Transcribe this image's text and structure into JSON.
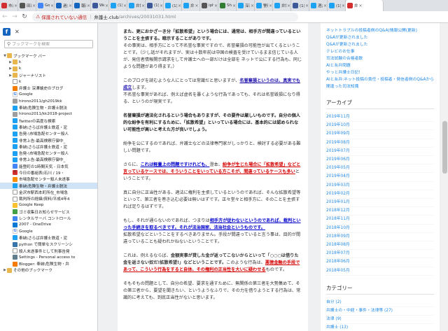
{
  "tabs": [
    {
      "title": "市長",
      "color": "#d32f2f"
    },
    {
      "title": "田口",
      "color": "#555555"
    },
    {
      "title": "Goog",
      "color": "#4285f4"
    },
    {
      "title": "過去",
      "color": "#1565c0"
    },
    {
      "title": "報道",
      "color": "#1565c0"
    },
    {
      "title": "Web",
      "color": "#3b5998"
    },
    {
      "title": "(1) ",
      "color": "#1da1f2"
    },
    {
      "title": "弁護",
      "color": "#1da1f2"
    },
    {
      "title": "(1)",
      "color": "#3b5998"
    },
    {
      "title": "(1) 弁",
      "color": "#1da1f2"
    },
    {
      "title": "弁",
      "color": "#1da1f2"
    },
    {
      "title": "iphor",
      "color": "#555555"
    },
    {
      "title": "Shok",
      "color": "#2e7d32"
    },
    {
      "title": "深澤",
      "color": "#1da1f2"
    },
    {
      "title": "警察",
      "color": "#1da1f2"
    },
    {
      "title": "弁護",
      "color": "#1da1f2"
    },
    {
      "title": "(1) 福",
      "color": "#3b5998"
    },
    {
      "title": "酒井",
      "color": "#1da1f2"
    },
    {
      "title": "(1) 弁",
      "color": "#1da1f2"
    },
    {
      "title": "弁",
      "color": "#d32f2f",
      "active": true
    }
  ],
  "address": {
    "warning": "保護されていない通信",
    "host": "弁護士.club",
    "path": "/archives/20031031.html"
  },
  "sidebar": {
    "search_placeholder": "ブックマークを検索",
    "items": [
      {
        "label": "ブックマーク バー",
        "icon": "folder-icon",
        "cls": "ico-folder",
        "indent": 0,
        "tw": "▼"
      },
      {
        "label": "k",
        "icon": "folder-icon",
        "cls": "ico-folder",
        "indent": 1,
        "tw": "▶"
      },
      {
        "label": "k",
        "icon": "folder-icon",
        "cls": "ico-folder",
        "indent": 1,
        "tw": "▶"
      },
      {
        "label": "ジャーナリスト",
        "icon": "folder-icon",
        "cls": "ico-folder",
        "indent": 1,
        "tw": "▶"
      },
      {
        "label": "k",
        "icon": "page-icon",
        "cls": "ico-page",
        "indent": 1
      },
      {
        "label": "弁護士 深澤諭史のブログ",
        "icon": "blog-icon",
        "cls": "ico-blog",
        "indent": 1
      },
      {
        "label": "Google",
        "icon": "google-icon",
        "cls": "ico-g",
        "glyph": "G",
        "indent": 1
      },
      {
        "label": "hirono2011/gh2019kk",
        "icon": "github-icon",
        "cls": "ico-gray",
        "indent": 1
      },
      {
        "label": "奉納\\危険生物・弁護士脱法",
        "icon": "twitter-icon",
        "cls": "ico-tw",
        "indent": 1
      },
      {
        "label": "hirono2011/kk2018-project",
        "icon": "github-icon",
        "cls": "ico-gray",
        "indent": 1
      },
      {
        "label": "Twitterの高度な検索",
        "icon": "twitter-icon",
        "cls": "ico-tw",
        "indent": 1
      },
      {
        "label": "奉納\\さらば弁護士鉄道・泥",
        "icon": "twitter-icon",
        "cls": "ico-tw",
        "indent": 1
      },
      {
        "label": "告発-\\市場急配センター殺人",
        "icon": "twitter-icon",
        "cls": "ico-tw",
        "indent": 1
      },
      {
        "label": "非常上告-最高検察庁御中_",
        "icon": "twitter-icon",
        "cls": "ico-tw",
        "indent": 1
      },
      {
        "label": "奉納\\さらば弁護士鉄道・泥",
        "icon": "twitter-icon",
        "cls": "ico-tw",
        "indent": 1
      },
      {
        "label": "告発-\\市場急配センター殺人",
        "icon": "twitter-icon",
        "cls": "ico-tw",
        "indent": 1
      },
      {
        "label": "非常上告-最高検察庁御中_",
        "icon": "twitter-icon",
        "cls": "ico-tw",
        "indent": 1
      },
      {
        "label": "能登町の1時間天気 - 日本気",
        "icon": "weather-icon",
        "cls": "ico-blue",
        "indent": 1
      },
      {
        "label": "今日の番組表(石川 / 19・",
        "icon": "yahoo-icon",
        "cls": "ico-red",
        "glyph": "Y",
        "indent": 1
      },
      {
        "label": "市場急配センター殺人未遂事",
        "icon": "alert-icon",
        "cls": "ico-alert",
        "indent": 1
      },
      {
        "label": "奉納\\危険生物・弁護士脱法",
        "icon": "twitter-icon",
        "cls": "ico-tw",
        "indent": 1,
        "sel": true
      },
      {
        "label": "金沢市駅西本町所在_市場急",
        "icon": "page-icon",
        "cls": "ico-page",
        "indent": 1
      },
      {
        "label": "裁判所の経緯/資料/平成4年4",
        "icon": "page-icon",
        "cls": "ico-page",
        "indent": 1
      },
      {
        "label": "Google Keep",
        "icon": "keep-icon",
        "cls": "ico-star",
        "indent": 1
      },
      {
        "label": "ゴミ収集日お知らせサービス",
        "icon": "page-icon",
        "cls": "ico-green",
        "indent": 1
      },
      {
        "label": "レンタルサーバ コントロール",
        "icon": "server-icon",
        "cls": "ico-blue",
        "indent": 1
      },
      {
        "label": "2007 - OneDrive",
        "icon": "onedrive-icon",
        "cls": "ico-od",
        "indent": 1
      },
      {
        "label": "Google",
        "icon": "google-icon",
        "cls": "ico-g",
        "glyph": "G",
        "indent": 1
      },
      {
        "label": "奉納\\さらば弁護士鉄道・泥",
        "icon": "twitter-icon",
        "cls": "ico-tw",
        "indent": 1
      },
      {
        "label": "python で簡単なスクリーンシ",
        "icon": "python-icon",
        "cls": "ico-py",
        "indent": 1
      },
      {
        "label": "殺人未遂事件として刑事告発",
        "icon": "page-icon",
        "cls": "ico-page",
        "indent": 1
      },
      {
        "label": "Settings - Personal access to",
        "icon": "settings-icon",
        "cls": "ico-set",
        "indent": 1
      },
      {
        "label": "Blogger: 奉納\\危険生物・弁",
        "icon": "blogger-icon",
        "cls": "ico-blog",
        "indent": 1
      },
      {
        "label": "その他のブックマーク",
        "icon": "folder-icon",
        "cls": "ico-folder",
        "indent": 0,
        "tw": "▶"
      }
    ]
  },
  "article": {
    "p1": "また、更におかざーき分「拡散希望」という場合には、通常は、相手方が間違っているということを主張する。暗示することがありです。",
    "p1b": "その事実は、相手方にとって不名誉な事実ですので、名誉棄損の可能性が出てくるということです。（少し話がそれますが、実は十数年前は中国の検査を受けているまま信じている人が、発信者情報開示請求をして弁護士への一部だけは全部を ネットで公にする行為も、同じような問題があり得ます。）",
    "p2a": "このブログを読むような人にとっては常識だと思いますが、",
    "p2link": "名誉棄損というのは、真実でも成立",
    "p2b": "します。",
    "p2c": "不名誉な事実があれば、例えば虚名を暴くような行為であっても、それは名誉毀損になり得る、というのが現実です。",
    "p3": "名誉棄損が適法化されるという場合もありますが、その要件は厳しいものです。自分の個人的な紛争を有利にするために、「拡散希望」といっている場合には、基本的には認められない可能性が高いと考えた方が良いでしょう。",
    "p4": "紛争を公にするのであれば、弁護士などの法律専門家がしっかりと、検討する必要がある難しい問題です。",
    "p5a": "さらに、",
    "p5blue": "これは軽量上の問題ですけれども、",
    "p5b": "澄本、",
    "p5red": "紛争が生じた場合に「拡散希望」などと言っているケースでは、そういうことをいっている方こそが、間違っているケースも多い",
    "p5c": "ということです。",
    "p6": "真に自分に正当性がある、適法に権利を主張しているというのであれば、そんな拡散希望等といって、第三者を巻き込む必要は無いはずです。正々堂々と相手方に、そのことを主張すれば足りるはずです。",
    "p7a": "もし、それが通らないのであれば、つまりは",
    "p7blue": "相手方が従わないというのであれば、裁判といった手続きを取るべきです。それが法治国家、法治社会というものです。",
    "p7b": "拡散希望などということをするべきありません。手段が間違っていると言う事は、目的が間違っていることも疑われかねないということです。",
    "p8a": "これは、例えるならば、",
    "p8bold": "金額実事が貸した金が返ってこないからといって「○○○は借りた金を返さない奴だ!拡散希望!」などということです。",
    "p8b": "このような行為は、",
    "p8red": "悪徳金融の手段であって、こういう行為をすると自体、その権利の正当性を大いに疑わせる",
    "p8c": "ものです。",
    "p9": "そもそもの問題として、自分の希望、要求を通すために、無関係の第三者を大勢集めて、その第三者から、要望を聞きたい、というようなふりで、その力を借りようとする行為は、常識的に考えても、到底正当性がないと思います。"
  },
  "right": {
    "links": [
      "ネットトラブルの投稿者側のQ&A(情報公開(更新)",
      "Q&Aが更新されました",
      "Q&Aが更新されました",
      "テレビのお仕事",
      "司法試験の合格者数",
      "AIと糸弁問題",
      "やっと弁護士日記!",
      "AIと糸弁:ネット投稿の責任・投稿者・発信者側のQ&Aから",
      "間違った司法知識"
    ],
    "archive_title": "アーカイブ",
    "archives": [
      "2019年11月",
      "2019年10月",
      "2019年09月",
      "2019年08月",
      "2019年07月",
      "2019年06月",
      "2019年05月",
      "2019年04月",
      "2019年03月",
      "2019年02月",
      "2019年01月",
      "2018年12月",
      "2018年11月",
      "2018年10月",
      "2018年09月",
      "2018年08月",
      "2018年07月",
      "2018年06月",
      "2018年05月"
    ],
    "category_title": "カテゴリー",
    "categories": [
      "自分 (2)",
      "弁護士の・中経・事件・法律等 (27)",
      "法律 (9)",
      "弁護士 (13)"
    ]
  }
}
